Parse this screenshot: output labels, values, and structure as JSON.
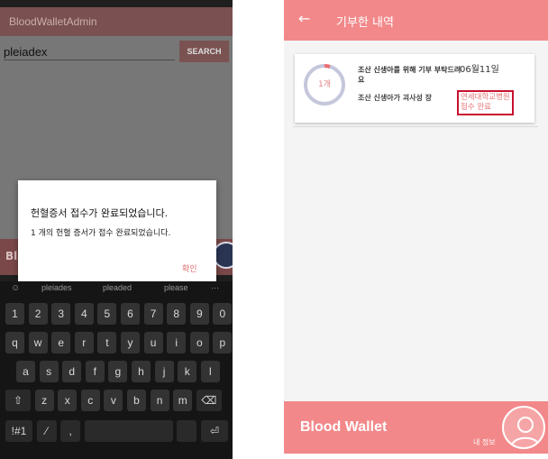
{
  "left": {
    "app_title": "BloodWalletAdmin",
    "search_value": "pleiadex",
    "search_button": "SEARCH",
    "band_text": "Bl",
    "dialog": {
      "title": "헌혈증서 접수가 완료되었습니다.",
      "message": "1 개의 헌혈 증서가 접수 완료되었습니다.",
      "ok": "확인"
    },
    "keyboard": {
      "suggestions": [
        "pleiades",
        "pleaded",
        "please"
      ],
      "rows": [
        [
          "1",
          "2",
          "3",
          "4",
          "5",
          "6",
          "7",
          "8",
          "9",
          "0"
        ],
        [
          "q",
          "w",
          "e",
          "r",
          "t",
          "y",
          "u",
          "i",
          "o",
          "p"
        ],
        [
          "a",
          "s",
          "d",
          "f",
          "g",
          "h",
          "j",
          "k",
          "l"
        ],
        [
          "⇧",
          "z",
          "x",
          "c",
          "v",
          "b",
          "n",
          "m",
          "⌫"
        ],
        [
          "!#1",
          "⁄",
          ",",
          "",
          "",
          "⏎"
        ]
      ]
    }
  },
  "right": {
    "header_title": "기부한 내역",
    "card": {
      "count": "1개",
      "title": "조산 신생아를 위해 기부 부탁드려요",
      "subtitle": "조산 신생아가 괴사성 장",
      "date": "06월11일",
      "hospital_line1": "연세대학교병원",
      "hospital_line2": "접수 완료"
    },
    "footer": {
      "brand": "Blood Wallet",
      "my_info": "내 정보"
    }
  },
  "colors": {
    "pink": "#f2888a",
    "status_red": "#c8102e"
  }
}
